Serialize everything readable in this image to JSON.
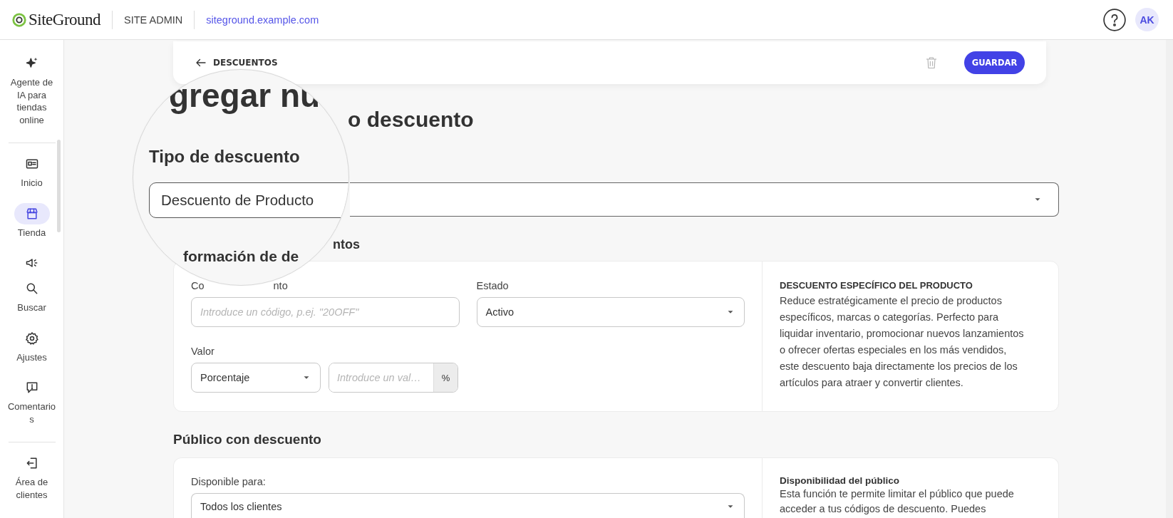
{
  "header": {
    "logo": "SiteGround",
    "section": "SITE ADMIN",
    "site_link": "siteground.example.com",
    "avatar": "AK"
  },
  "sidebar": {
    "items": [
      {
        "label": "Agente de IA para tiendas online",
        "selected": false
      },
      {
        "label": "Inicio",
        "selected": false
      },
      {
        "label": "Tienda",
        "selected": true
      },
      {
        "selected": false
      },
      {
        "label": "Buscar",
        "selected": false
      },
      {
        "label": "Ajustes",
        "selected": false
      },
      {
        "label": "Comentarios",
        "selected": false
      },
      {
        "label": "Área de clientes",
        "selected": false
      }
    ]
  },
  "topbar": {
    "back_label": "DESCUENTOS",
    "save_button": "GUARDAR"
  },
  "title_visible": "o descuento",
  "lens": {
    "title": "gregar nu",
    "type_heading": "Tipo de descuento",
    "type_value": "Descuento de Producto",
    "info_heading": "formación de de"
  },
  "info_heading_visible": "ntos",
  "discount_info": {
    "code_label_visible": [
      "Co",
      "nto"
    ],
    "code_placeholder": "Introduce un código, p.ej. \"20OFF\"",
    "status_label": "Estado",
    "status_value": "Activo",
    "value_label": "Valor",
    "value_type": "Porcentaje",
    "value_placeholder": "Introduce un val…",
    "value_unit": "%",
    "help_title": "DESCUENTO ESPECÍFICO DEL PRODUCTO",
    "help_text": "Reduce estratégicamente el precio de productos específicos, marcas o categorías. Perfecto para liquidar inventario, promocionar nuevos lanzamientos o ofrecer ofertas especiales en los más vendidos, este descuento baja directamente los precios de los artículos para atraer y convertir clientes."
  },
  "audience": {
    "heading": "Público con descuento",
    "available_label": "Disponible para:",
    "available_value": "Todos los clientes",
    "help_title": "Disponibilidad del público",
    "help_text": "Esta función te permite limitar el público que puede acceder a tus códigos de descuento. Puedes"
  }
}
